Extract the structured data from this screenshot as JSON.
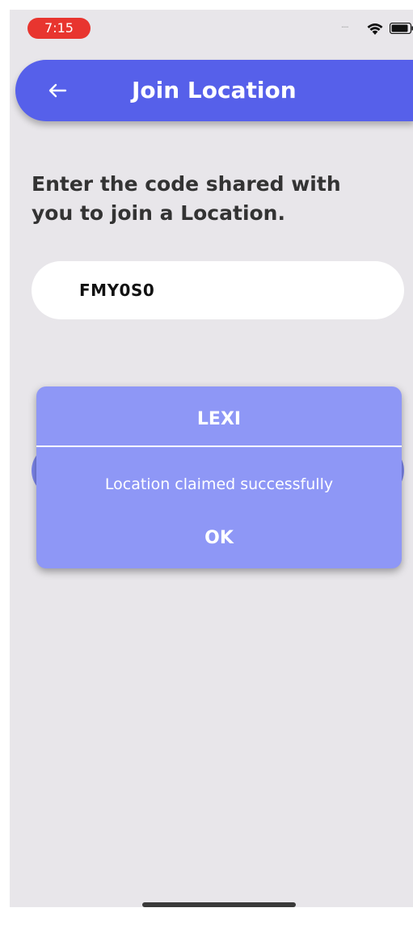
{
  "status_bar": {
    "time": "7:15",
    "signal": "....",
    "icons": [
      "wifi-icon",
      "battery-icon"
    ]
  },
  "app_bar": {
    "title": "Join Location",
    "back_icon": "arrow-left-icon"
  },
  "content": {
    "instructions": "Enter the code shared with you to join a Location.",
    "code_value": "FMY0S0"
  },
  "dialog": {
    "title": "LEXI",
    "message": "Location claimed successfully",
    "ok_label": "OK"
  },
  "colors": {
    "primary": "#5660ea",
    "dialog": "#8e97f6",
    "background": "#e8e6ea",
    "time_pill": "#e8352f"
  }
}
